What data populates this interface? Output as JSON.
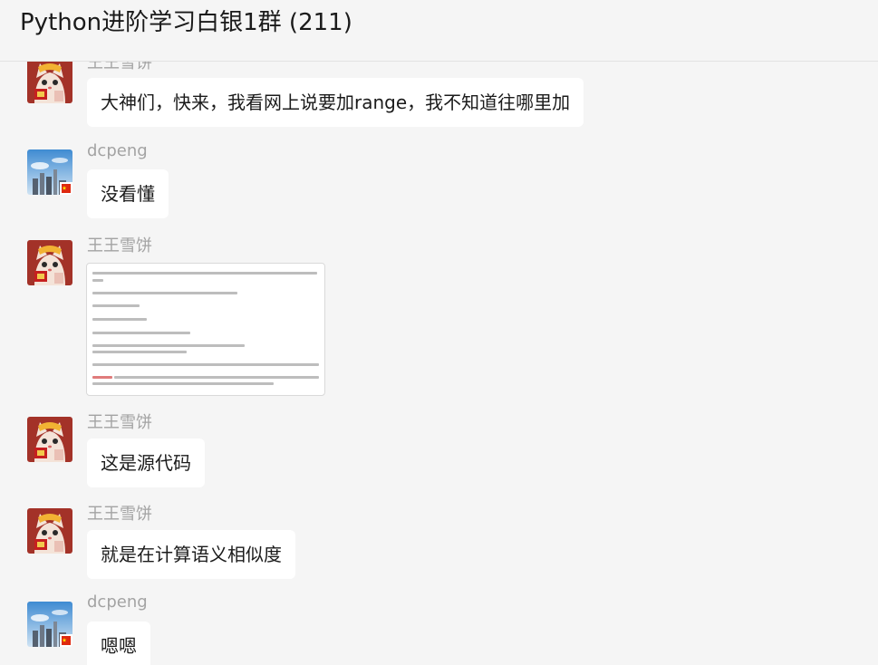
{
  "window": {
    "title": "Python进阶学习白银1群 (211)"
  },
  "messages": [
    {
      "sender": "王王雪饼",
      "text": "大神们，快来，我看网上说要加range，我不知道往哪里加",
      "avatar": "cat-avatar"
    },
    {
      "sender": "dcpeng",
      "text": "没看懂",
      "avatar": "city-avatar"
    },
    {
      "sender": "王王雪饼",
      "text": "",
      "type": "image",
      "avatar": "cat-avatar"
    },
    {
      "sender": "王王雪饼",
      "text": "这是源代码",
      "avatar": "cat-avatar"
    },
    {
      "sender": "王王雪饼",
      "text": "就是在计算语义相似度",
      "avatar": "cat-avatar"
    },
    {
      "sender": "dcpeng",
      "text": "嗯嗯",
      "avatar": "city-avatar"
    }
  ],
  "colors": {
    "background": "#f5f5f5",
    "bubble": "#ffffff",
    "sender": "#a3a3a3"
  }
}
